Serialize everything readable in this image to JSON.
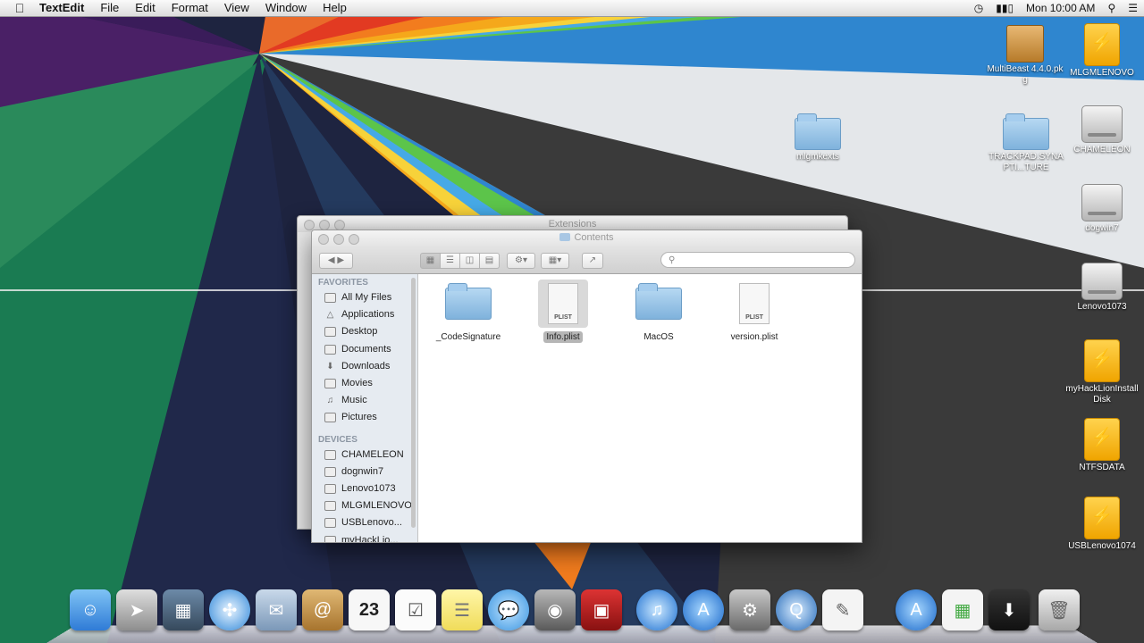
{
  "menubar": {
    "app_name": "TextEdit",
    "menus": [
      "File",
      "Edit",
      "Format",
      "View",
      "Window",
      "Help"
    ],
    "clock": "Mon 10:00 AM"
  },
  "desktop_icons": [
    {
      "label": "MultiBeast 4.4.0.pkg",
      "icon": "package-icon"
    },
    {
      "label": "MLGMLENOVO",
      "icon": "usb-drive-icon"
    },
    {
      "label": "mlgmkexts",
      "icon": "folder-icon"
    },
    {
      "label": "TRACKPAD.SYNAPTI...TURE",
      "icon": "folder-icon"
    },
    {
      "label": "CHAMELEON",
      "icon": "hard-drive-icon"
    },
    {
      "label": "dogwin7",
      "icon": "hard-drive-icon"
    },
    {
      "label": "Lenovo1073",
      "icon": "hard-drive-icon"
    },
    {
      "label": "myHackLionInstall Disk",
      "icon": "usb-drive-icon"
    },
    {
      "label": "NTFSDATA",
      "icon": "usb-drive-icon"
    },
    {
      "label": "USBLenovo1074",
      "icon": "usb-drive-icon"
    }
  ],
  "back_window": {
    "title": "Extensions"
  },
  "finder": {
    "title": "Contents",
    "search_placeholder": "",
    "sidebar": {
      "favorites_heading": "FAVORITES",
      "favorites": [
        {
          "label": "All My Files",
          "icon": "all-files-icon"
        },
        {
          "label": "Applications",
          "icon": "applications-icon"
        },
        {
          "label": "Desktop",
          "icon": "desktop-icon"
        },
        {
          "label": "Documents",
          "icon": "documents-icon"
        },
        {
          "label": "Downloads",
          "icon": "downloads-icon"
        },
        {
          "label": "Movies",
          "icon": "movies-icon"
        },
        {
          "label": "Music",
          "icon": "music-icon"
        },
        {
          "label": "Pictures",
          "icon": "pictures-icon"
        }
      ],
      "devices_heading": "DEVICES",
      "devices": [
        {
          "label": "CHAMELEON"
        },
        {
          "label": "dognwin7"
        },
        {
          "label": "Lenovo1073"
        },
        {
          "label": "MLGMLENOVO"
        },
        {
          "label": "USBLenovo..."
        },
        {
          "label": "myHackLio..."
        }
      ]
    },
    "files": [
      {
        "name": "_CodeSignature",
        "kind": "folder",
        "selected": false
      },
      {
        "name": "Info.plist",
        "kind": "plist",
        "tag": "PLIST",
        "selected": true
      },
      {
        "name": "MacOS",
        "kind": "folder",
        "selected": false
      },
      {
        "name": "version.plist",
        "kind": "plist",
        "tag": "PLIST",
        "selected": false
      }
    ]
  },
  "dock": {
    "calendar_day": "23",
    "items": [
      "finder-icon",
      "launchpad-icon",
      "mission-control-icon",
      "safari-icon",
      "mail-icon",
      "contacts-icon",
      "calendar-icon",
      "reminders-icon",
      "notes-icon",
      "messages-icon",
      "facetime-icon",
      "photo-booth-icon",
      "itunes-icon",
      "app-store-icon",
      "system-preferences-icon",
      "quicktime-icon",
      "textedit-icon",
      "applications-stack-icon",
      "documents-stack-icon",
      "downloads-stack-icon",
      "trash-icon"
    ]
  },
  "colors": {
    "finder_sidebar": "#e6ebf1",
    "selection": "#b6b6b6",
    "folder_blue": "#8fbce2"
  }
}
